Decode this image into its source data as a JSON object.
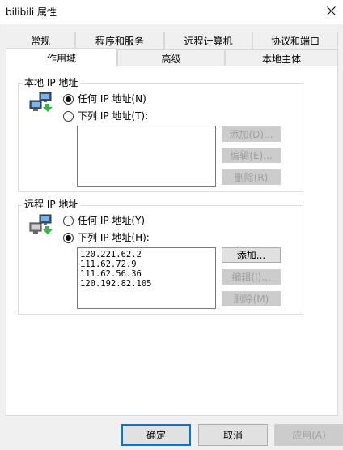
{
  "window": {
    "title": "bilibili 属性"
  },
  "tabs_row1": [
    {
      "label": "常规"
    },
    {
      "label": "程序和服务"
    },
    {
      "label": "远程计算机"
    },
    {
      "label": "协议和端口"
    }
  ],
  "tabs_row2": [
    {
      "label": "作用域",
      "active": true
    },
    {
      "label": "高级"
    },
    {
      "label": "本地主体"
    }
  ],
  "local": {
    "group_label": "本地 IP 地址",
    "option_any": "任何 IP 地址(N)",
    "option_list": "下列 IP 地址(T):",
    "selected": "any",
    "addresses": [],
    "add_label": "添加(D)...",
    "edit_label": "编辑(E)...",
    "remove_label": "删除(R)"
  },
  "remote": {
    "group_label": "远程 IP 地址",
    "option_any": "任何 IP 地址(Y)",
    "option_list": "下列 IP 地址(H):",
    "selected": "list",
    "addresses": [
      "120.221.62.2",
      "111.62.72.9",
      "111.62.56.36",
      "120.192.82.105"
    ],
    "add_label": "添加...",
    "edit_label": "编辑(I)...",
    "remove_label": "删除(M)"
  },
  "footer": {
    "ok_label": "确定",
    "cancel_label": "取消",
    "apply_label": "应用(A)"
  },
  "colors": {
    "accent": "#0078d7",
    "disabled_text": "#a0a0a0"
  },
  "icons": [
    "close-icon",
    "network-computers-icon"
  ]
}
